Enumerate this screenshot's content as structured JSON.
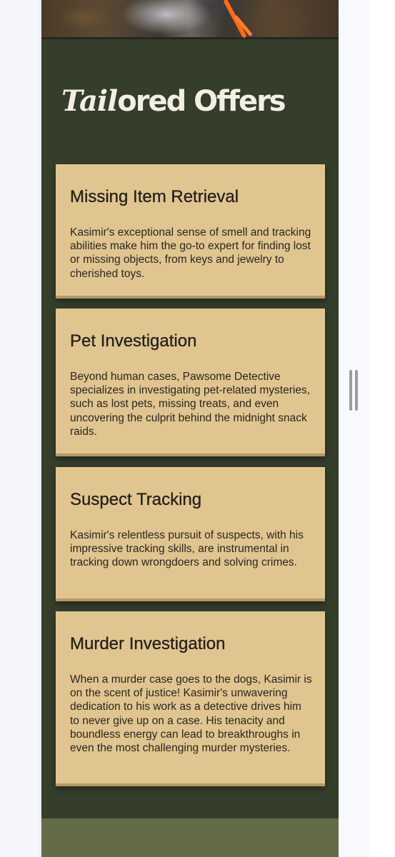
{
  "section": {
    "title_script": "Tail",
    "title_rest": "ored Offers"
  },
  "cards": [
    {
      "title": "Missing Item Retrieval",
      "description": "Kasimir's exceptional sense of smell and tracking abilities make him the go-to expert for finding lost or missing objects, from keys and jewelry to cherished toys."
    },
    {
      "title": "Pet Investigation",
      "description": "Beyond human cases, Pawsome Detective specializes in investigating pet-related mysteries, such as lost pets, missing treats, and even uncovering the culprit behind the midnight snack raids."
    },
    {
      "title": "Suspect Tracking",
      "description": "Kasimir's relentless pursuit of suspects, with his impressive tracking skills, are instrumental in tracking down wrongdoers and solving crimes."
    },
    {
      "title": "Murder Investigation",
      "description": "When a murder case goes to the dogs, Kasimir is on the scent of justice! Kasimir's unwavering dedication to his work as a detective drives him to never give up on a case. His tenacity and boundless energy can lead to breakthroughs in even the most challenging murder mysteries."
    }
  ],
  "colors": {
    "section_background": "#353d2b",
    "card_background": "#e0c590",
    "footer_band": "#646b47",
    "title_text": "#f3efe4"
  },
  "icons": {
    "resize_handle": "drag-handle-icon"
  }
}
